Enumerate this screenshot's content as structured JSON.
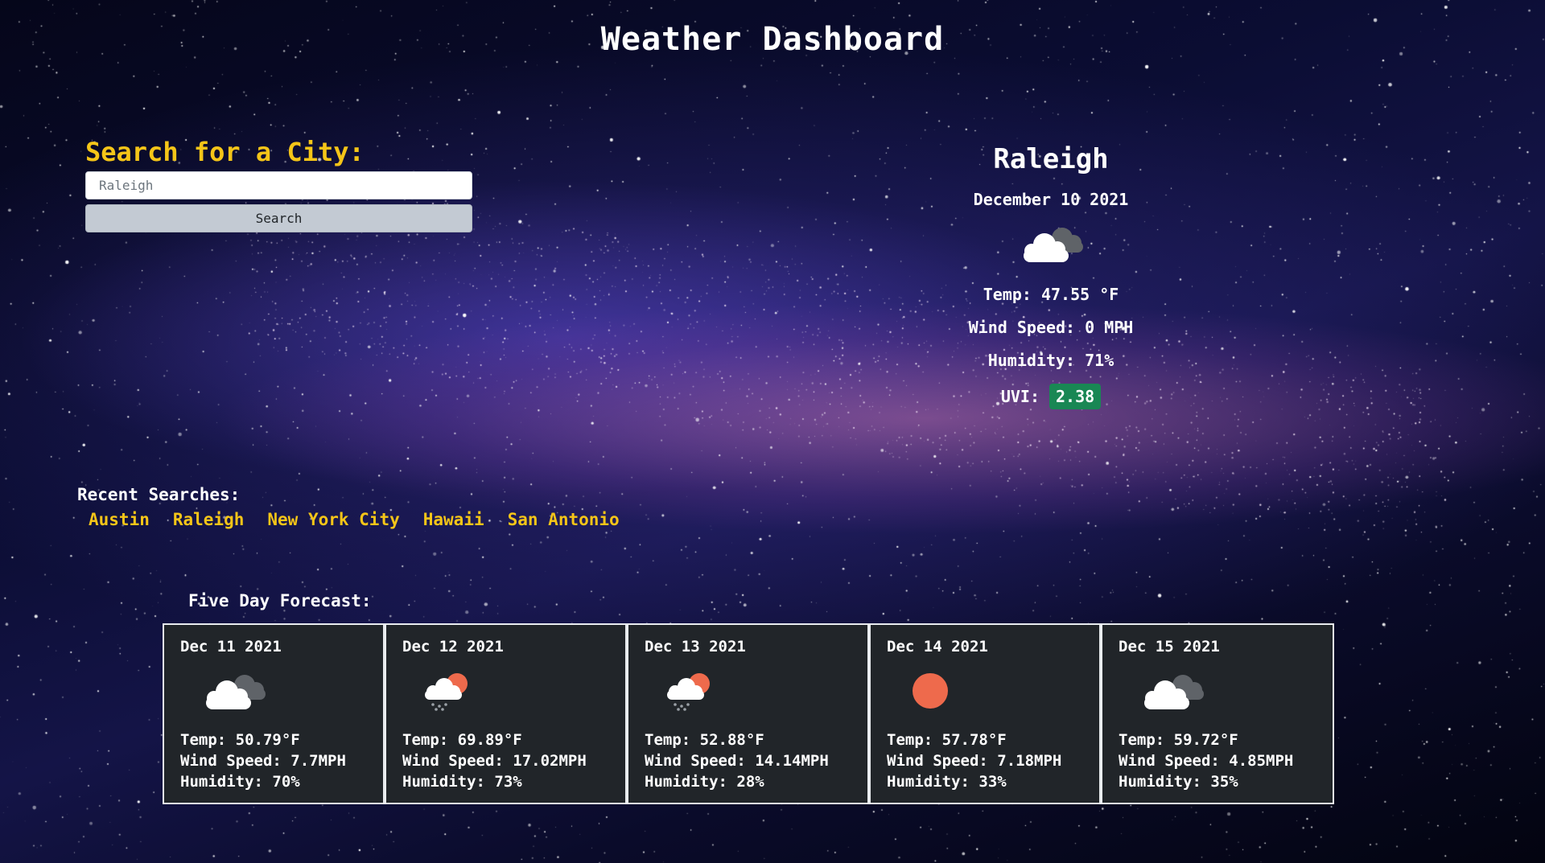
{
  "header": {
    "title": "Weather Dashboard"
  },
  "search": {
    "heading": "Search for a City:",
    "input_value": "",
    "placeholder": "Raleigh",
    "button_label": "Search"
  },
  "current": {
    "city": "Raleigh",
    "date": "December 10 2021",
    "icon": "cloudy-icon",
    "temp": "Temp: 47.55 °F",
    "wind": "Wind Speed: 0 MPH",
    "humidity": "Humidity: 71%",
    "uvi_label": "UVI:",
    "uvi_value": "2.38",
    "uvi_color": "#198754"
  },
  "recent": {
    "label": "Recent Searches:",
    "items": [
      "Austin",
      "Raleigh",
      "New York City",
      "Hawaii",
      "San Antonio"
    ]
  },
  "forecast": {
    "label": "Five Day Forecast:",
    "days": [
      {
        "date": "Dec 11 2021",
        "icon": "cloudy-icon",
        "temp": "Temp: 50.79°F",
        "wind": "Wind Speed: 7.7MPH",
        "humidity": "Humidity: 70%"
      },
      {
        "date": "Dec 12 2021",
        "icon": "rain-sun-icon",
        "temp": "Temp: 69.89°F",
        "wind": "Wind Speed: 17.02MPH",
        "humidity": "Humidity: 73%"
      },
      {
        "date": "Dec 13 2021",
        "icon": "rain-sun-icon",
        "temp": "Temp: 52.88°F",
        "wind": "Wind Speed: 14.14MPH",
        "humidity": "Humidity: 28%"
      },
      {
        "date": "Dec 14 2021",
        "icon": "sun-icon",
        "temp": "Temp: 57.78°F",
        "wind": "Wind Speed: 7.18MPH",
        "humidity": "Humidity: 33%"
      },
      {
        "date": "Dec 15 2021",
        "icon": "cloudy-icon",
        "temp": "Temp: 59.72°F",
        "wind": "Wind Speed: 4.85MPH",
        "humidity": "Humidity: 35%"
      }
    ]
  },
  "colors": {
    "accent": "#f5c518",
    "card_bg": "#212529",
    "sun": "#ee6a4c"
  }
}
